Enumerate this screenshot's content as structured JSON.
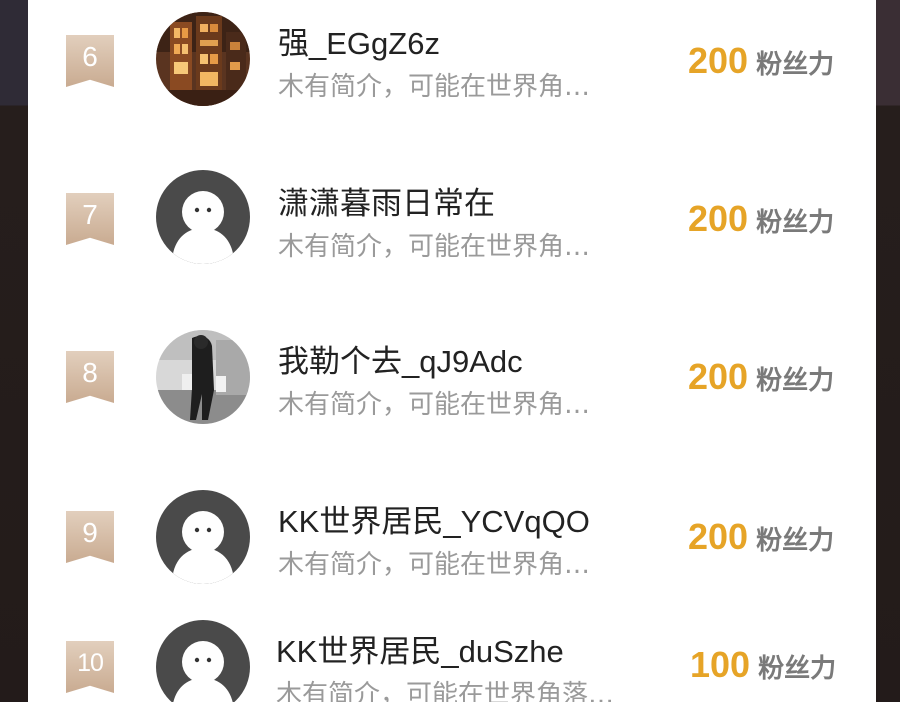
{
  "rows": [
    {
      "rank": "6",
      "name": "强_EGgZ6z",
      "bio": "木有简介，可能在世界角…",
      "score": "200",
      "unit": "粉丝力",
      "avatar": "photo-city-night"
    },
    {
      "rank": "7",
      "name": "潇潇暮雨日常在",
      "bio": "木有简介，可能在世界角…",
      "score": "200",
      "unit": "粉丝力",
      "avatar": "default-avatar"
    },
    {
      "rank": "8",
      "name": "我勒个去_qJ9Adc",
      "bio": "木有简介，可能在世界角…",
      "score": "200",
      "unit": "粉丝力",
      "avatar": "photo-bw-person"
    },
    {
      "rank": "9",
      "name": "KK世界居民_YCVqQO",
      "bio": "木有简介，可能在世界角…",
      "score": "200",
      "unit": "粉丝力",
      "avatar": "default-avatar"
    },
    {
      "rank": "10",
      "name": "KK世界居民_duSzhe",
      "bio": "木有简介，可能在世界角落…",
      "score": "100",
      "unit": "粉丝力",
      "avatar": "default-avatar"
    }
  ],
  "colors": {
    "score": "#e6a427",
    "badge": "#d6bca4",
    "name": "#222222",
    "bio": "#9a9a9a"
  }
}
